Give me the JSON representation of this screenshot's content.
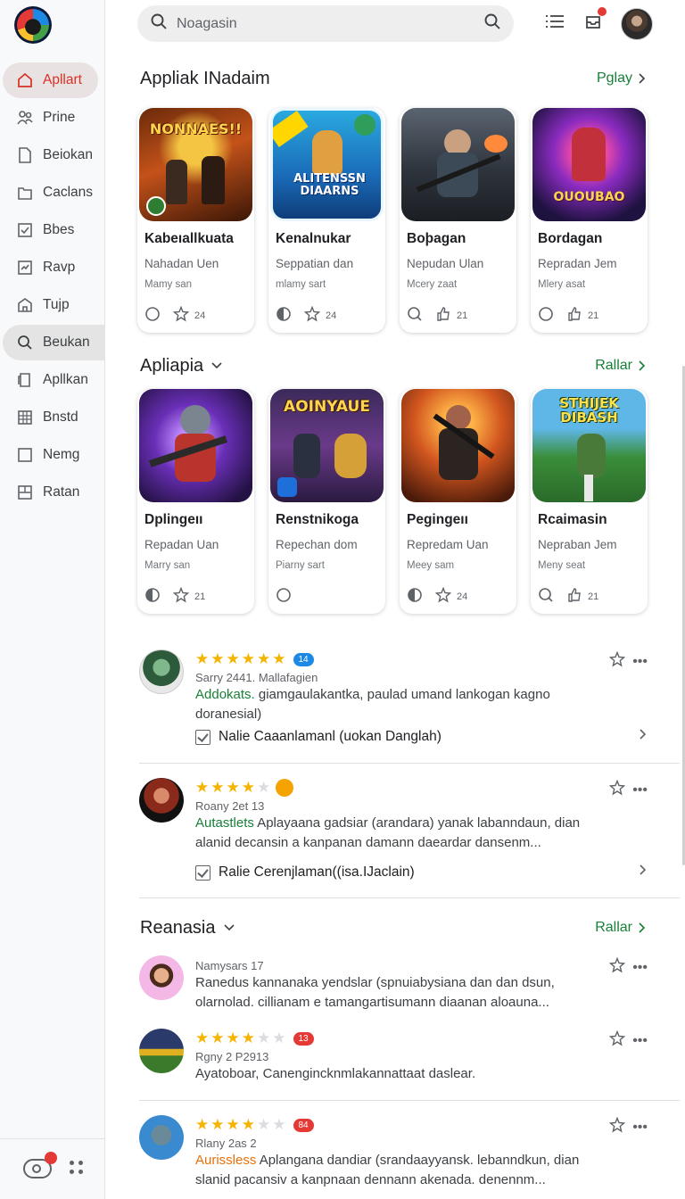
{
  "sidebar": {
    "items": [
      {
        "label": "Apllart",
        "icon": "home-icon"
      },
      {
        "label": "Prine",
        "icon": "people-icon"
      },
      {
        "label": "Beiokan",
        "icon": "document-icon"
      },
      {
        "label": "Caclans",
        "icon": "folder-icon"
      },
      {
        "label": "Bbes",
        "icon": "check-box-icon"
      },
      {
        "label": "Ravp",
        "icon": "chart-box-icon"
      },
      {
        "label": "Tujp",
        "icon": "house-outline-icon"
      },
      {
        "label": "Beukan",
        "icon": "search-icon"
      },
      {
        "label": "Apllkan",
        "icon": "page-icon"
      },
      {
        "label": "Bnstd",
        "icon": "grid-icon"
      },
      {
        "label": "Nemg",
        "icon": "square-icon"
      },
      {
        "label": "Ratan",
        "icon": "layout-icon"
      }
    ]
  },
  "search": {
    "placeholder": "Noagasin"
  },
  "sections": {
    "first": {
      "title": "Appliak INadaim",
      "more": "Pglay",
      "cards": [
        {
          "title": "Kabeıallkuata",
          "sub": "Nahadan Uen",
          "meta": "Mamy san",
          "count": "24",
          "art_text": "NONNAES!!"
        },
        {
          "title": "Kenalnukar",
          "sub": "Seppatian dan",
          "meta": "mlamy sart",
          "count": "24",
          "art_text": "ALITENSSN DIAARNS"
        },
        {
          "title": "Boþagan",
          "sub": "Nepudan Ulan",
          "meta": "Mcery zaat",
          "count": "21",
          "art_text": ""
        },
        {
          "title": "Bordagan",
          "sub": "Repradan Jem",
          "meta": "Mlery asat",
          "count": "21",
          "art_text": "OUOUBAO"
        }
      ]
    },
    "second": {
      "title": "Apliapia",
      "more": "Rallar",
      "cards": [
        {
          "title": "Dplingeıı",
          "sub": "Repadan Uan",
          "meta": "Marry san",
          "count": "21",
          "art_text": ""
        },
        {
          "title": "Renstnikoga",
          "sub": "Repechan dom",
          "meta": "Piarny sart",
          "count": "",
          "art_text": "AOINYAUE"
        },
        {
          "title": "Pegingeıı",
          "sub": "Repredam Uan",
          "meta": "Meey sam",
          "count": "24",
          "art_text": ""
        },
        {
          "title": "Rcaimasin",
          "sub": "Nepraban Jem",
          "meta": "Meny seat",
          "count": "21",
          "art_text": "STHIJEK DIBASH"
        }
      ]
    },
    "third": {
      "title": "Reanasia",
      "more": "Rallar"
    }
  },
  "reviews": [
    {
      "meta": "Sarry 2441. Mallafagien",
      "highlight": "Addokats.",
      "text": " giamgaulakantka, paulad umand lankogan kagno doranesial)",
      "stars": 5,
      "pill": "14",
      "pill_color": "#1e88e5",
      "action": "Nalie Caaanlamanl (uokan Danglah)"
    },
    {
      "meta": "Roany 2et 13",
      "highlight": "Autastlets",
      "text": " Aplayaana gadsiar (arandara) yanak labanndaun, dian alanid decansin a kanpanan damann daeardar dansenm...",
      "stars": 4,
      "pill": "",
      "pill_color": "#f4b400",
      "action": "Ralie Cerenjlaman((isa.IJaclain)"
    },
    {
      "meta": "Namysars 17",
      "highlight": "",
      "text": "Ranedus kannanaka yendslar (spnuiabysiana dan dan dsun, olarnolad. cillianam e tamangartisumann diaanan aloauna...",
      "stars": 0,
      "pill": "",
      "pill_color": "",
      "action": ""
    },
    {
      "meta": "Rgny 2 P2913",
      "highlight": "",
      "text": "Ayatoboar, Canengincknmlakannattaat daslear.",
      "stars": 4,
      "pill": "13",
      "pill_color": "#e53935",
      "action": ""
    },
    {
      "meta": "Rlany 2as 2",
      "highlight": "Aurissless",
      "text": " Aplangana dandiar (srandaayyansk. lebanndkun, dian slanid pacansiv a kanpnaan dennann akenada. denennm...",
      "stars": 4,
      "pill": "84",
      "pill_color": "#e53935",
      "action": ""
    }
  ],
  "colors": {
    "accent_red": "#d93025",
    "link_green": "#188038",
    "star": "#f4b400"
  }
}
